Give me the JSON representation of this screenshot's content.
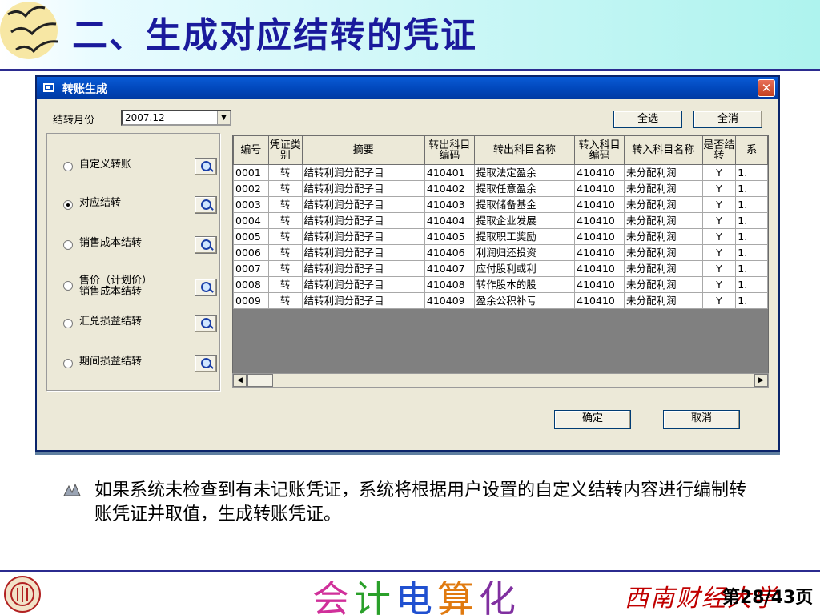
{
  "slide": {
    "title": "二、生成对应结转的凭证",
    "bullet": "如果系统未检查到有未记账凭证，系统将根据用户设置的自定义结转内容进行编制转账凭证并取值，生成转账凭证。",
    "brand": [
      "会",
      "计",
      "电",
      "算",
      "化"
    ],
    "brand_colors": [
      "#d0309a",
      "#2aa02a",
      "#2050d0",
      "#e07a10",
      "#8030a0"
    ],
    "school": "西南财经大学",
    "page": "第28/43页"
  },
  "window": {
    "title": "转账生成",
    "close_icon": "close-icon",
    "month_label": "结转月份",
    "month_value": "2007.12",
    "select_all": "全选",
    "deselect_all": "全消",
    "ok": "确定",
    "cancel": "取消",
    "options": [
      {
        "label": "自定义转账",
        "checked": false
      },
      {
        "label": "对应结转",
        "checked": true
      },
      {
        "label": "销售成本结转",
        "checked": false
      },
      {
        "label_line1": "售价（计划价）",
        "label_line2": "销售成本结转",
        "checked": false
      },
      {
        "label": "汇兑损益结转",
        "checked": false
      },
      {
        "label": "期间损益结转",
        "checked": false
      }
    ],
    "grid": {
      "headers": [
        "编号",
        "凭证类别",
        "摘要",
        "转出科目编码",
        "转出科目名称",
        "转入科目编码",
        "转入科目名称",
        "是否结转",
        "系"
      ],
      "rows": [
        [
          "0001",
          "转",
          "结转利润分配子目",
          "410401",
          "提取法定盈余",
          "410410",
          "未分配利润",
          "Y",
          "1."
        ],
        [
          "0002",
          "转",
          "结转利润分配子目",
          "410402",
          "提取任意盈余",
          "410410",
          "未分配利润",
          "Y",
          "1."
        ],
        [
          "0003",
          "转",
          "结转利润分配子目",
          "410403",
          "提取储备基金",
          "410410",
          "未分配利润",
          "Y",
          "1."
        ],
        [
          "0004",
          "转",
          "结转利润分配子目",
          "410404",
          "提取企业发展",
          "410410",
          "未分配利润",
          "Y",
          "1."
        ],
        [
          "0005",
          "转",
          "结转利润分配子目",
          "410405",
          "提取职工奖励",
          "410410",
          "未分配利润",
          "Y",
          "1."
        ],
        [
          "0006",
          "转",
          "结转利润分配子目",
          "410406",
          "利润归还投资",
          "410410",
          "未分配利润",
          "Y",
          "1."
        ],
        [
          "0007",
          "转",
          "结转利润分配子目",
          "410407",
          "应付股利或利",
          "410410",
          "未分配利润",
          "Y",
          "1."
        ],
        [
          "0008",
          "转",
          "结转利润分配子目",
          "410408",
          "转作股本的股",
          "410410",
          "未分配利润",
          "Y",
          "1."
        ],
        [
          "0009",
          "转",
          "结转利润分配子目",
          "410409",
          "盈余公积补亏",
          "410410",
          "未分配利润",
          "Y",
          "1."
        ]
      ]
    }
  }
}
